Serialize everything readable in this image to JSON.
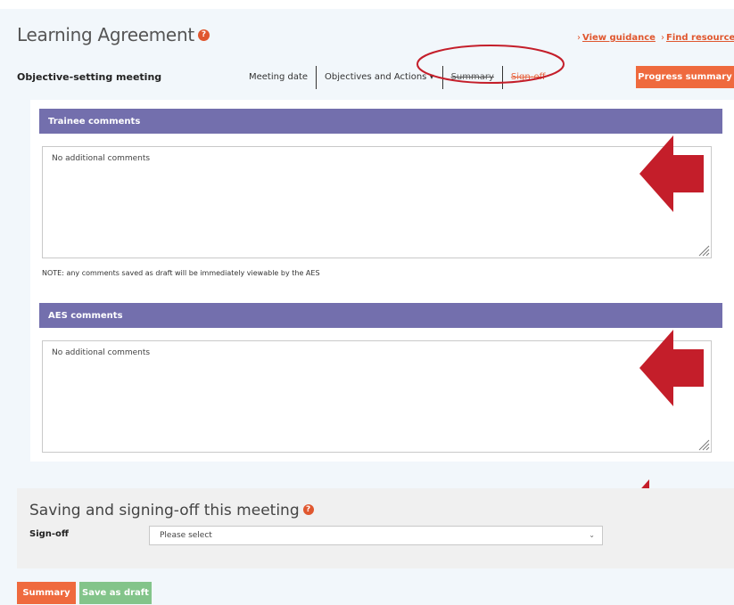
{
  "header": {
    "title": "Learning Agreement",
    "links": [
      {
        "chevron": "›",
        "label": "View guidance"
      },
      {
        "chevron": "›",
        "label": "Find resources"
      }
    ],
    "subtitle": "Objective-setting meeting"
  },
  "tabs": [
    {
      "label": "Meeting date"
    },
    {
      "label": "Objectives and Actions ▾"
    },
    {
      "label": "Summary"
    },
    {
      "label": "Sign-off"
    }
  ],
  "progress_button": {
    "label": "Progress summary"
  },
  "trainee": {
    "heading": "Trainee comments",
    "value": "No additional comments",
    "note": "NOTE: any comments saved as draft will be immediately viewable by the AES"
  },
  "aes": {
    "heading": "AES comments",
    "value": "No additional comments"
  },
  "save_section": {
    "title": "Saving and signing-off this meeting",
    "signoff_label": "Sign-off",
    "signoff_selected": "Please select"
  },
  "footer_buttons": {
    "summary": "Summary",
    "save_draft": "Save as draft"
  },
  "icons": {
    "help": "question-circle-icon",
    "caret": "chevron-down-icon",
    "grip": "resize-grip-icon"
  },
  "colors": {
    "accent": "#ef6a3e",
    "section_header": "#736fad",
    "draft_button": "#83c48a",
    "annotation_red": "#c41e2a"
  }
}
